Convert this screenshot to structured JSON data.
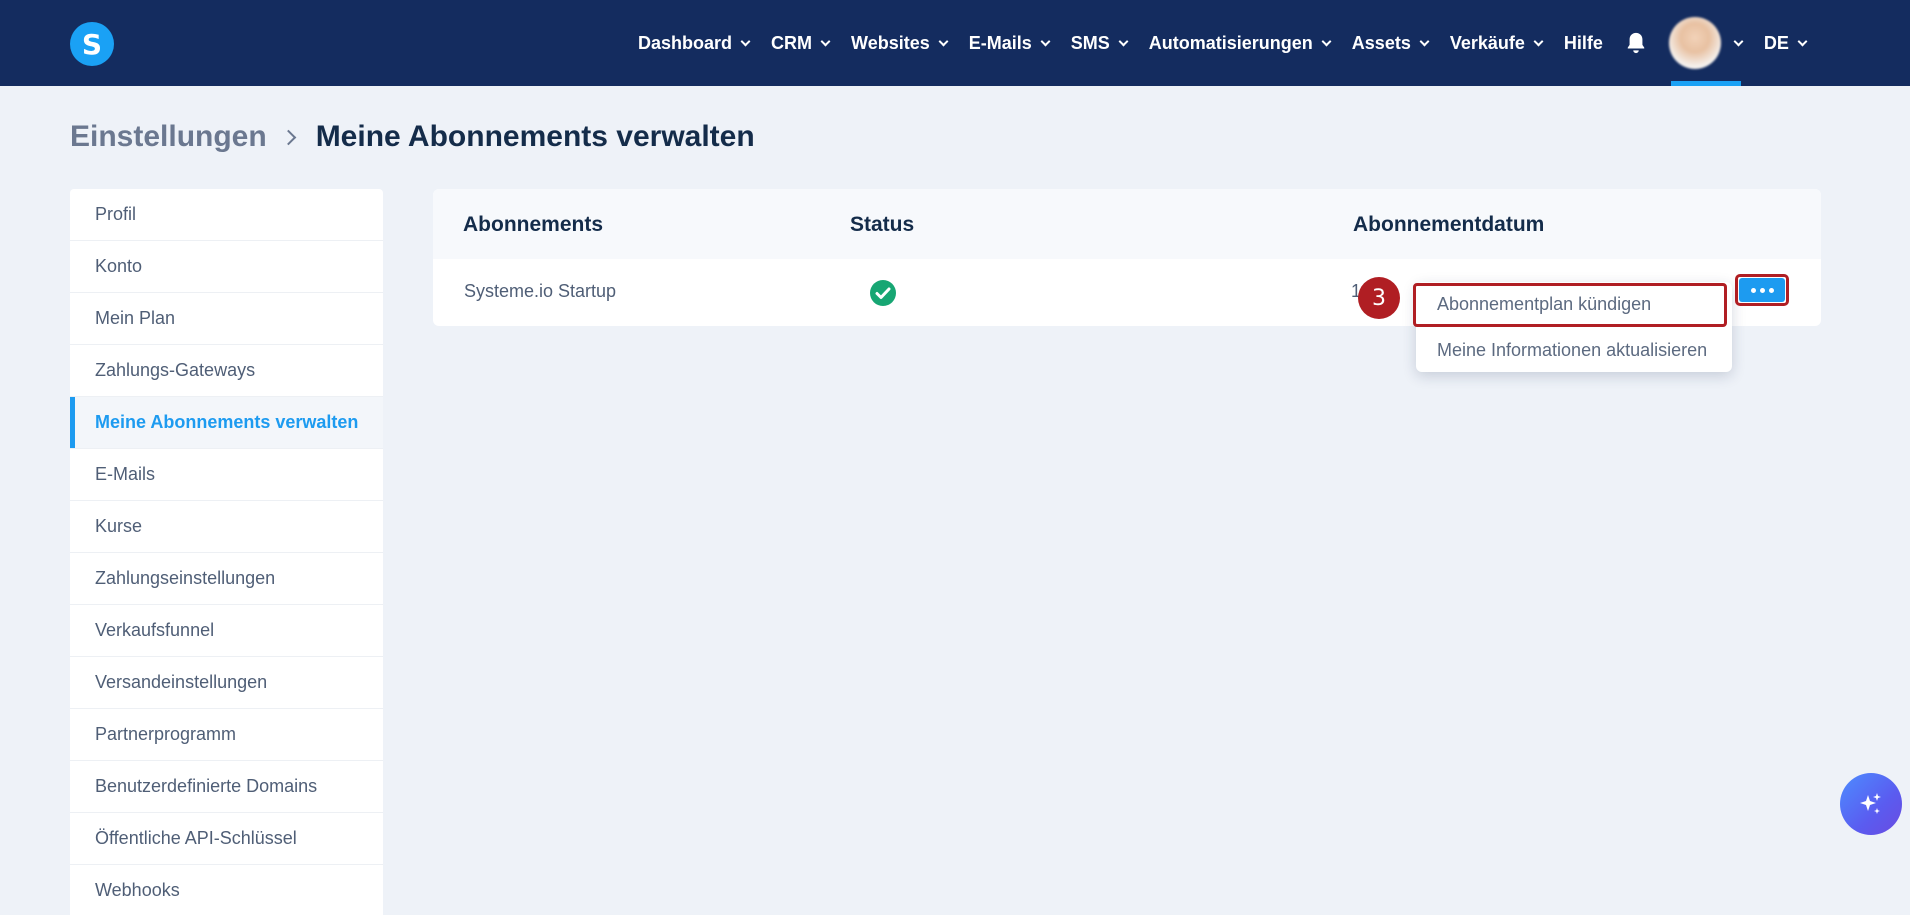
{
  "topbar": {
    "logo_letter": "S",
    "nav": [
      {
        "label": "Dashboard"
      },
      {
        "label": "CRM"
      },
      {
        "label": "Websites"
      },
      {
        "label": "E-Mails"
      },
      {
        "label": "SMS"
      },
      {
        "label": "Automatisierungen"
      },
      {
        "label": "Assets"
      },
      {
        "label": "Verkäufe"
      }
    ],
    "help_label": "Hilfe",
    "language": "DE",
    "accent_color": "#1aa1f5",
    "bar_color": "#142c5f"
  },
  "breadcrumb": {
    "parent": "Einstellungen",
    "current": "Meine Abonnements verwalten"
  },
  "sidebar": {
    "items": [
      {
        "label": "Profil"
      },
      {
        "label": "Konto"
      },
      {
        "label": "Mein Plan"
      },
      {
        "label": "Zahlungs-Gateways"
      },
      {
        "label": "Meine Abonnements verwalten",
        "active": true
      },
      {
        "label": "E-Mails"
      },
      {
        "label": "Kurse"
      },
      {
        "label": "Zahlungseinstellungen"
      },
      {
        "label": "Verkaufsfunnel"
      },
      {
        "label": "Versandeinstellungen"
      },
      {
        "label": "Partnerprogramm"
      },
      {
        "label": "Benutzerdefinierte Domains"
      },
      {
        "label": "Öffentliche API-Schlüssel"
      },
      {
        "label": "Webhooks"
      }
    ]
  },
  "table": {
    "headers": {
      "subscriptions": "Abonnements",
      "status": "Status",
      "date": "Abonnementdatum"
    },
    "rows": [
      {
        "name": "Systeme.io Startup",
        "status_icon": "check-circle-icon",
        "date_partial": "1  20"
      }
    ]
  },
  "dropdown": {
    "items": [
      {
        "label": "Abonnementplan kündigen"
      },
      {
        "label": "Meine Informationen aktualisieren"
      }
    ]
  },
  "annotation": {
    "step": "3",
    "color": "#b01e23"
  }
}
